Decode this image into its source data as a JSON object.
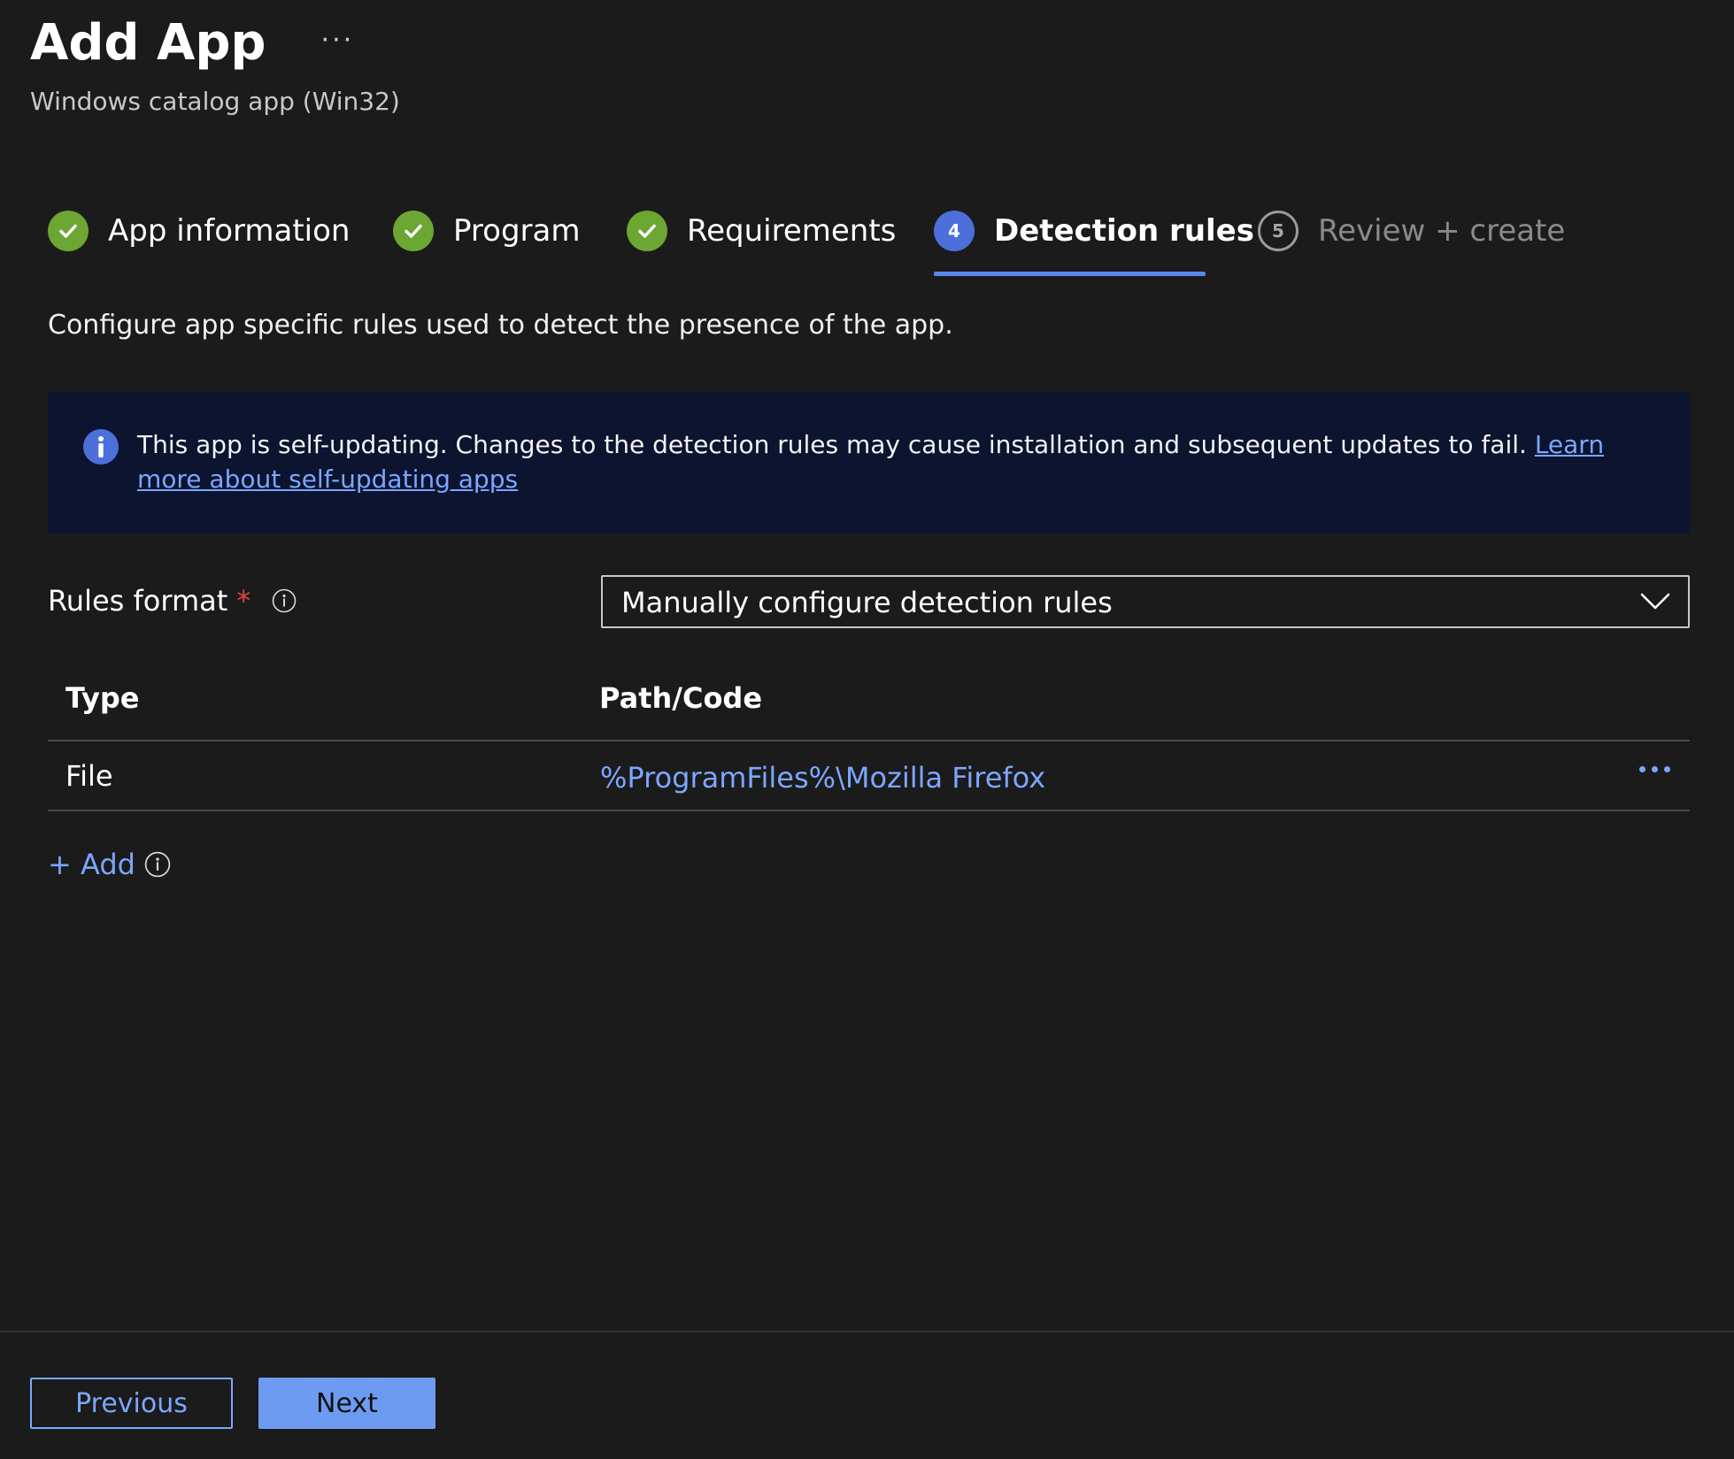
{
  "header": {
    "title": "Add App",
    "more_label": "···",
    "subtitle": "Windows catalog app (Win32)"
  },
  "steps": [
    {
      "label": "App information",
      "state": "done"
    },
    {
      "label": "Program",
      "state": "done"
    },
    {
      "label": "Requirements",
      "state": "done"
    },
    {
      "label": "Detection rules",
      "state": "current",
      "number": "4"
    },
    {
      "label": "Review + create",
      "state": "todo",
      "number": "5"
    }
  ],
  "description": "Configure app specific rules used to detect the presence of the app.",
  "banner": {
    "message": "This app is self-updating. Changes to the detection rules may cause installation and subsequent updates to fail. ",
    "link_text": "Learn more about self-updating apps"
  },
  "rules_format": {
    "label": "Rules format",
    "required_marker": "*",
    "selected_value": "Manually configure detection rules"
  },
  "table": {
    "headers": [
      "Type",
      "Path/Code"
    ],
    "rows": [
      {
        "type": "File",
        "path": "%ProgramFiles%\\Mozilla Firefox"
      }
    ]
  },
  "add_label": "+ Add",
  "footer": {
    "previous_label": "Previous",
    "next_label": "Next"
  },
  "colors": {
    "background": "#1b1b1b",
    "accent": "#5b86f0",
    "link": "#7ca6ff",
    "success": "#6ca633",
    "banner_bg": "#0c1430",
    "required": "#e0453c"
  }
}
